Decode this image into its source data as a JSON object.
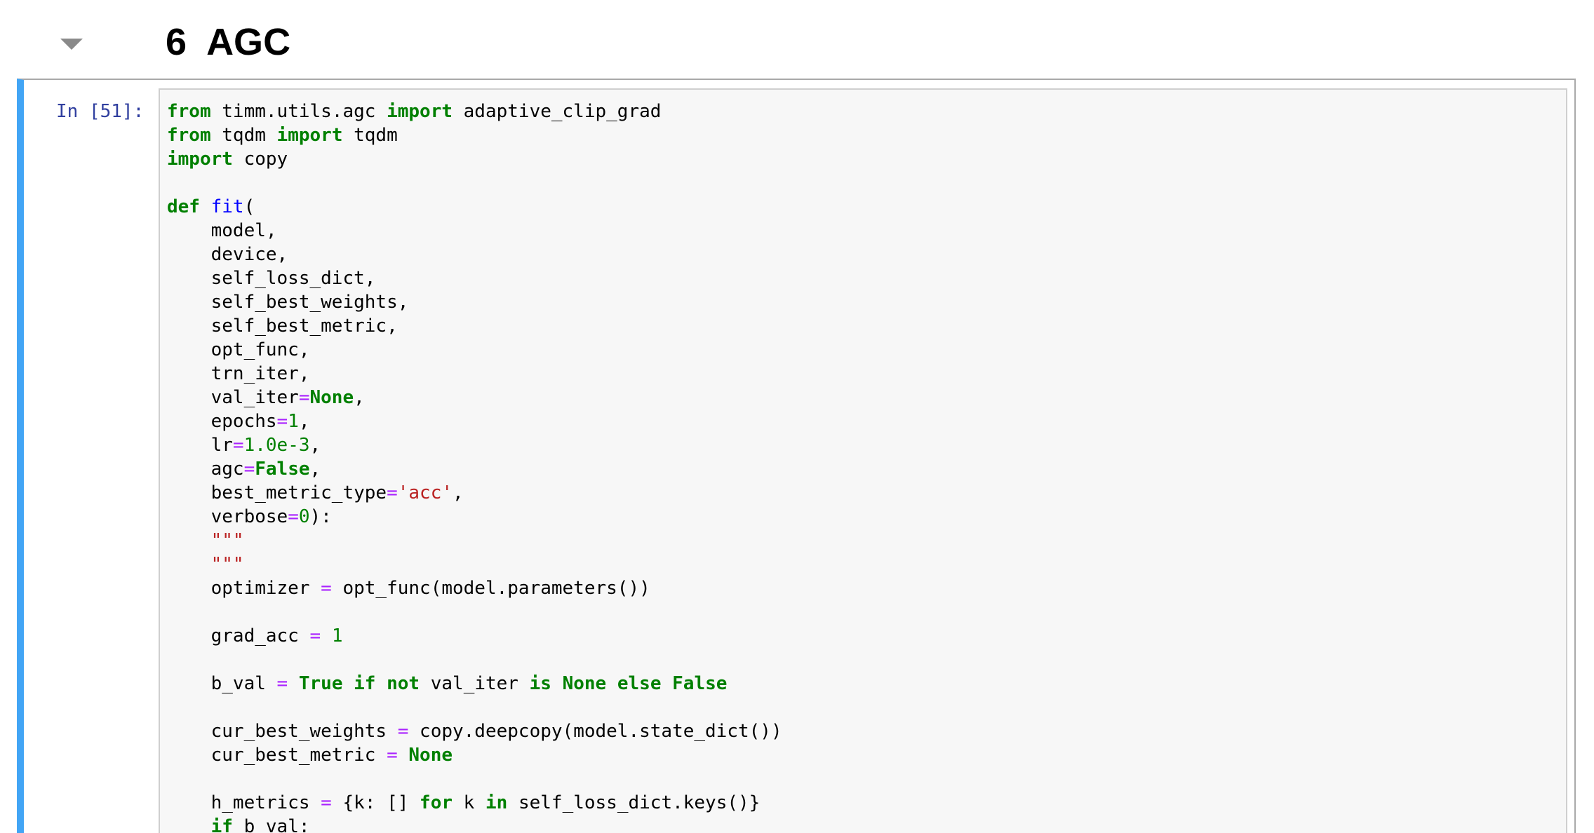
{
  "section": {
    "number": "6",
    "title": "AGC"
  },
  "cell": {
    "prompt": "In [51]:",
    "code_lines": [
      [
        [
          "from",
          "kw"
        ],
        [
          " timm.utils.agc ",
          ""
        ],
        [
          "import",
          "kw"
        ],
        [
          " adaptive_clip_grad",
          ""
        ]
      ],
      [
        [
          "from",
          "kw"
        ],
        [
          " tqdm ",
          ""
        ],
        [
          "import",
          "kw"
        ],
        [
          " tqdm",
          ""
        ]
      ],
      [
        [
          "import",
          "kw"
        ],
        [
          " copy",
          ""
        ]
      ],
      [],
      [
        [
          "def",
          "kw"
        ],
        [
          " ",
          ""
        ],
        [
          "fit",
          "fn"
        ],
        [
          "(",
          ""
        ]
      ],
      [
        [
          "    model,",
          ""
        ]
      ],
      [
        [
          "    device,",
          ""
        ]
      ],
      [
        [
          "    self_loss_dict,",
          ""
        ]
      ],
      [
        [
          "    self_best_weights,",
          ""
        ]
      ],
      [
        [
          "    self_best_metric,",
          ""
        ]
      ],
      [
        [
          "    opt_func,",
          ""
        ]
      ],
      [
        [
          "    trn_iter,",
          ""
        ]
      ],
      [
        [
          "    val_iter",
          ""
        ],
        [
          "=",
          "op"
        ],
        [
          "None",
          "kw"
        ],
        [
          ",",
          ""
        ]
      ],
      [
        [
          "    epochs",
          ""
        ],
        [
          "=",
          "op"
        ],
        [
          "1",
          "num"
        ],
        [
          ",",
          ""
        ]
      ],
      [
        [
          "    lr",
          ""
        ],
        [
          "=",
          "op"
        ],
        [
          "1.0e-3",
          "num"
        ],
        [
          ",",
          ""
        ]
      ],
      [
        [
          "    agc",
          ""
        ],
        [
          "=",
          "op"
        ],
        [
          "False",
          "kw"
        ],
        [
          ",",
          ""
        ]
      ],
      [
        [
          "    best_metric_type",
          ""
        ],
        [
          "=",
          "op"
        ],
        [
          "'acc'",
          "str"
        ],
        [
          ",",
          ""
        ]
      ],
      [
        [
          "    verbose",
          ""
        ],
        [
          "=",
          "op"
        ],
        [
          "0",
          "num"
        ],
        [
          "):",
          ""
        ]
      ],
      [
        [
          "    ",
          ""
        ],
        [
          "\"\"\"",
          "str"
        ]
      ],
      [
        [
          "    ",
          ""
        ],
        [
          "\"\"\"",
          "str"
        ]
      ],
      [
        [
          "    optimizer ",
          ""
        ],
        [
          "=",
          "op"
        ],
        [
          " opt_func(model.parameters())",
          ""
        ]
      ],
      [],
      [
        [
          "    grad_acc ",
          ""
        ],
        [
          "=",
          "op"
        ],
        [
          " ",
          ""
        ],
        [
          "1",
          "num"
        ]
      ],
      [],
      [
        [
          "    b_val ",
          ""
        ],
        [
          "=",
          "op"
        ],
        [
          " ",
          ""
        ],
        [
          "True",
          "kw"
        ],
        [
          " ",
          ""
        ],
        [
          "if",
          "kw"
        ],
        [
          " ",
          ""
        ],
        [
          "not",
          "kw"
        ],
        [
          " val_iter ",
          ""
        ],
        [
          "is",
          "kw"
        ],
        [
          " ",
          ""
        ],
        [
          "None",
          "kw"
        ],
        [
          " ",
          ""
        ],
        [
          "else",
          "kw"
        ],
        [
          " ",
          ""
        ],
        [
          "False",
          "kw"
        ]
      ],
      [],
      [
        [
          "    cur_best_weights ",
          ""
        ],
        [
          "=",
          "op"
        ],
        [
          " copy.deepcopy(model.state_dict())",
          ""
        ]
      ],
      [
        [
          "    cur_best_metric ",
          ""
        ],
        [
          "=",
          "op"
        ],
        [
          " ",
          ""
        ],
        [
          "None",
          "kw"
        ]
      ],
      [],
      [
        [
          "    h_metrics ",
          ""
        ],
        [
          "=",
          "op"
        ],
        [
          " {k: [] ",
          ""
        ],
        [
          "for",
          "kw"
        ],
        [
          " k ",
          ""
        ],
        [
          "in",
          "kw"
        ],
        [
          " self_loss_dict.keys()}",
          ""
        ]
      ],
      [
        [
          "    ",
          ""
        ],
        [
          "if",
          "kw"
        ],
        [
          " b_val:",
          ""
        ]
      ]
    ]
  }
}
